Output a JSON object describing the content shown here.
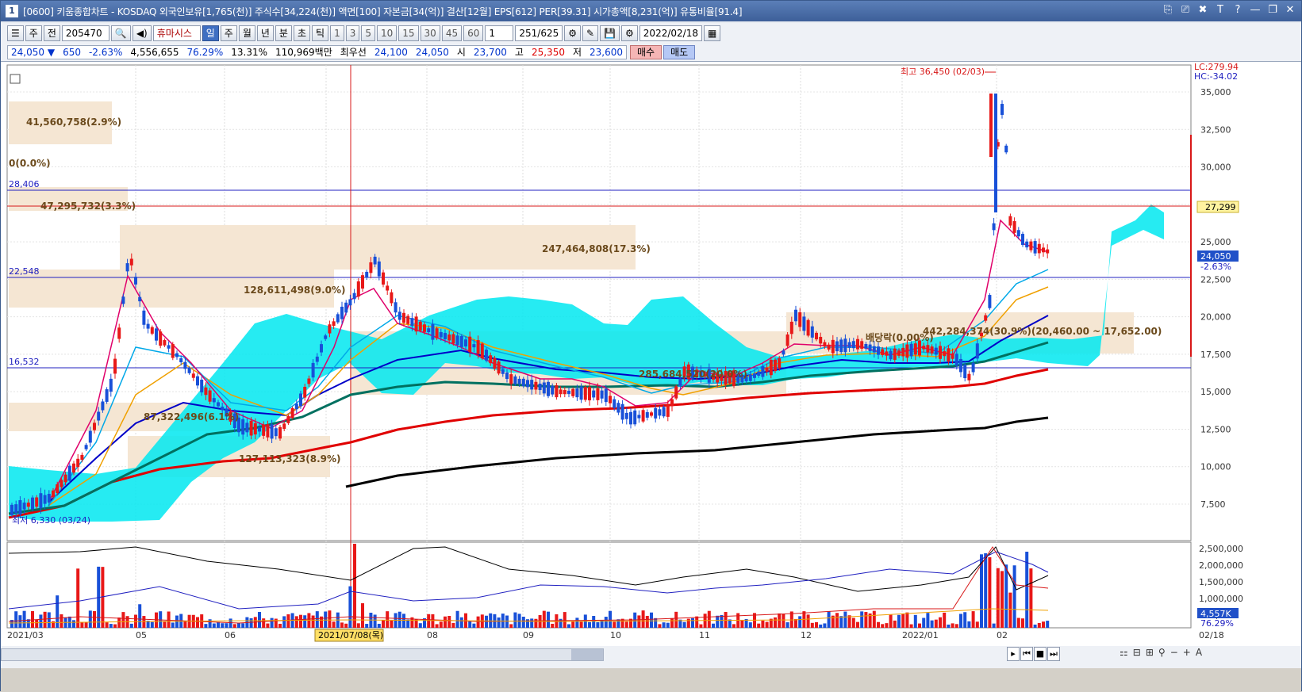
{
  "window": {
    "id": "1",
    "title": "[0600] 키움종합차트 - KOSDAQ 외국인보유[1,765(천)] 주식수[34,224(천)] 액면[100] 자본금[34(억)] 결산[12월] EPS[612] PER[39.31] 시가총액[8,231(억)] 유통비율[91.4]",
    "title_buttons": [
      "⎘",
      "⎚",
      "✖",
      "T",
      "?",
      "—",
      "❐",
      "✕"
    ]
  },
  "toolbar": {
    "period_label": "주",
    "prev_label": "전",
    "code": "205470",
    "search_icon": "🔍",
    "name": "휴마시스",
    "period_tabs": [
      "일",
      "주",
      "월",
      "년",
      "분",
      "초",
      "틱"
    ],
    "selected_tab": "일",
    "minute_units": [
      "1",
      "3",
      "5",
      "10",
      "15",
      "30",
      "45",
      "60"
    ],
    "count_label": "1",
    "page_count": "251/625",
    "date": "2022/02/18"
  },
  "quote": {
    "price": "24,050",
    "arrow": "▼",
    "change": "650",
    "change_pct": "-2.63%",
    "volume": "4,556,655",
    "vol_ratio": "76.29%",
    "turnover": "13.31%",
    "amount": "110,969백만",
    "bid_label": "최우선",
    "bid": "24,100",
    "ask": "24,050",
    "open_label": "시",
    "open": "23,700",
    "high_label": "고",
    "high": "25,350",
    "low_label": "저",
    "low": "23,600",
    "buy_label": "매수",
    "sell_label": "매도"
  },
  "chart": {
    "lc_label": "LC:279.94",
    "hc_label": "HC:-34.02",
    "y_ticks": [
      "35,000",
      "32,500",
      "30,000",
      "27,500",
      "25,000",
      "22,500",
      "20,000",
      "17,500",
      "15,000",
      "12,500",
      "10,000",
      "7,500"
    ],
    "price_tag": "27,299",
    "current_tag": "24,050",
    "current_pct": "-2.63%",
    "max_label": "최고 36,450 (02/03)",
    "min_label": "최저 6,330 (03/24)",
    "h_lines": [
      {
        "label": "28,406",
        "color": "#2020c0"
      },
      {
        "label": "22,548",
        "color": "#2020c0"
      },
      {
        "label": "16,532",
        "color": "#2020c0"
      }
    ],
    "vol_profile": [
      {
        "label": "41,560,758(2.9%)"
      },
      {
        "label": "0(0.0%)"
      },
      {
        "label": "47,295,732(3.3%)"
      },
      {
        "label": "247,464,808(17.3%)"
      },
      {
        "label": "128,611,498(9.0%)"
      },
      {
        "label": "87,322,496(6.1%)"
      },
      {
        "label": "127,113,323(8.9%)"
      },
      {
        "label": "285,684,520(20.0%)"
      },
      {
        "label": "442,284,374(30.9%)(20,460.00 ~ 17,652.00)"
      },
      {
        "label": "배당락(0.00%)"
      }
    ],
    "sub_y_ticks": [
      "2,500,000",
      "2,000,000",
      "1,500,000",
      "1,000,000",
      "500,000"
    ],
    "sub_tag_vol": "4,557K",
    "sub_tag_pct": "76.29%",
    "x_labels": [
      "2021/03",
      "05",
      "06",
      "2021/07/08(목)",
      "08",
      "09",
      "10",
      "11",
      "12",
      "2022/01",
      "02",
      "02/18"
    ],
    "colors": {
      "ma5": "#e0006a",
      "ma10": "#00a8e8",
      "ma20": "#f0a000",
      "ma60": "#0000c8",
      "ma120": "#007060",
      "ma240": "#e00000",
      "ma480": "#000000",
      "cloud": "#00e8f0",
      "profile": "#f5e6d3",
      "up": "#e81818",
      "down": "#1850d8"
    }
  },
  "nav": {
    "buttons": [
      "▸",
      "⏮",
      "■",
      "⏭"
    ],
    "right": [
      "⚏",
      "⊟",
      "⊞",
      "⚲",
      "−",
      "+",
      "A"
    ]
  }
}
